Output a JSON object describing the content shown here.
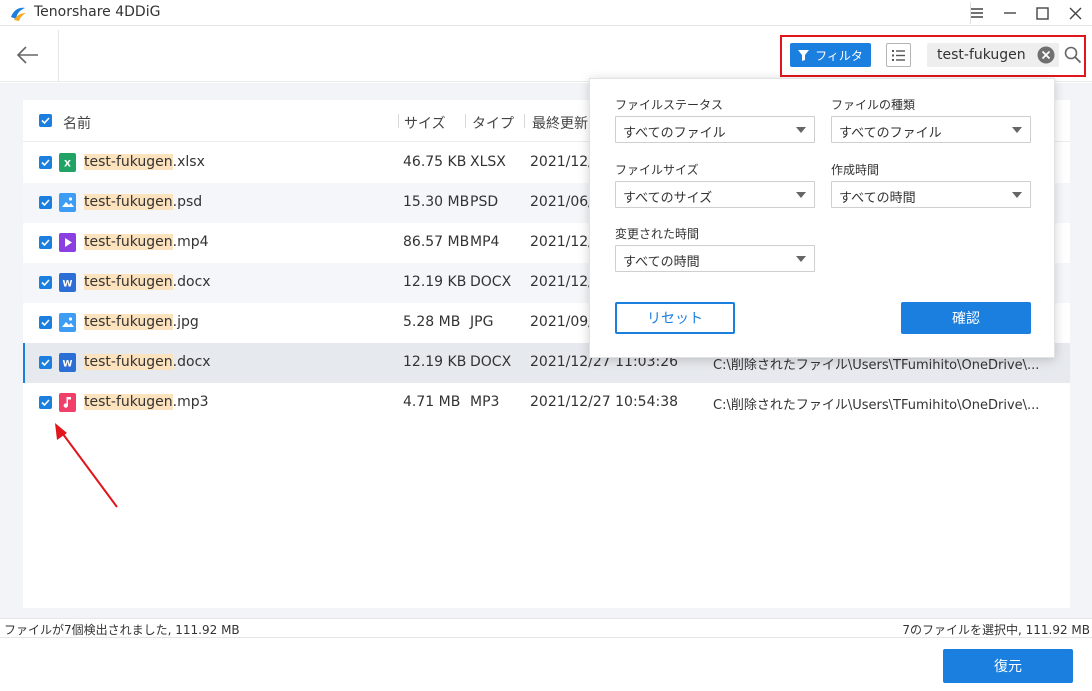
{
  "app": {
    "title": "Tenorshare 4DDiG"
  },
  "toolbar": {
    "filter_label": "フィルタ",
    "search_value": "test-fukugen"
  },
  "table": {
    "columns": [
      "名前",
      "サイズ",
      "タイプ",
      "最終更新"
    ],
    "rows": [
      {
        "prefix": "test-fukugen",
        "ext": ".xlsx",
        "size": "46.75 KB",
        "type": "XLSX",
        "date": "2021/12/",
        "path": "",
        "icon": "excel-file-icon",
        "color": "#21a366"
      },
      {
        "prefix": "test-fukugen",
        "ext": ".psd",
        "size": "15.30 MB",
        "type": "PSD",
        "date": "2021/06/",
        "path": "",
        "icon": "image-file-icon",
        "color": "#3d9df5"
      },
      {
        "prefix": "test-fukugen",
        "ext": ".mp4",
        "size": "86.57 MB",
        "type": "MP4",
        "date": "2021/12/",
        "path": "",
        "icon": "video-file-icon",
        "color": "#8b3fe0"
      },
      {
        "prefix": "test-fukugen",
        "ext": ".docx",
        "size": "12.19 KB",
        "type": "DOCX",
        "date": "2021/12/",
        "path": "",
        "icon": "word-file-icon",
        "color": "#2b6fd6"
      },
      {
        "prefix": "test-fukugen",
        "ext": ".jpg",
        "size": "5.28 MB",
        "type": "JPG",
        "date": "2021/09/",
        "path": "",
        "icon": "image-file-icon",
        "color": "#3d9df5"
      },
      {
        "prefix": "test-fukugen",
        "ext": ".docx",
        "size": "12.19 KB",
        "type": "DOCX",
        "date": "2021/12/27 11:03:26",
        "path": "C:\\削除されたファイル\\Users\\TFumihito\\OneDrive\\...",
        "icon": "word-file-icon",
        "color": "#2b6fd6"
      },
      {
        "prefix": "test-fukugen",
        "ext": ".mp3",
        "size": "4.71 MB",
        "type": "MP3",
        "date": "2021/12/27 10:54:38",
        "path": "C:\\削除されたファイル\\Users\\TFumihito\\OneDrive\\...",
        "icon": "audio-file-icon",
        "color": "#f0406a"
      }
    ]
  },
  "filter_popup": {
    "status_label": "ファイルステータス",
    "status_value": "すべてのファイル",
    "kind_label": "ファイルの種類",
    "kind_value": "すべてのファイル",
    "size_label": "ファイルサイズ",
    "size_value": "すべてのサイズ",
    "created_label": "作成時間",
    "created_value": "すべての時間",
    "modified_label": "変更された時間",
    "modified_value": "すべての時間",
    "reset_label": "リセット",
    "confirm_label": "確認"
  },
  "status": {
    "found": "ファイルが7個検出されました, 111.92 MB",
    "selected": "7のファイルを選択中, 111.92 MB"
  },
  "footer": {
    "recover_label": "復元"
  },
  "colors": {
    "accent": "#1b7fe0",
    "highlight": "#fde3bd",
    "annotation": "#e0161c"
  }
}
